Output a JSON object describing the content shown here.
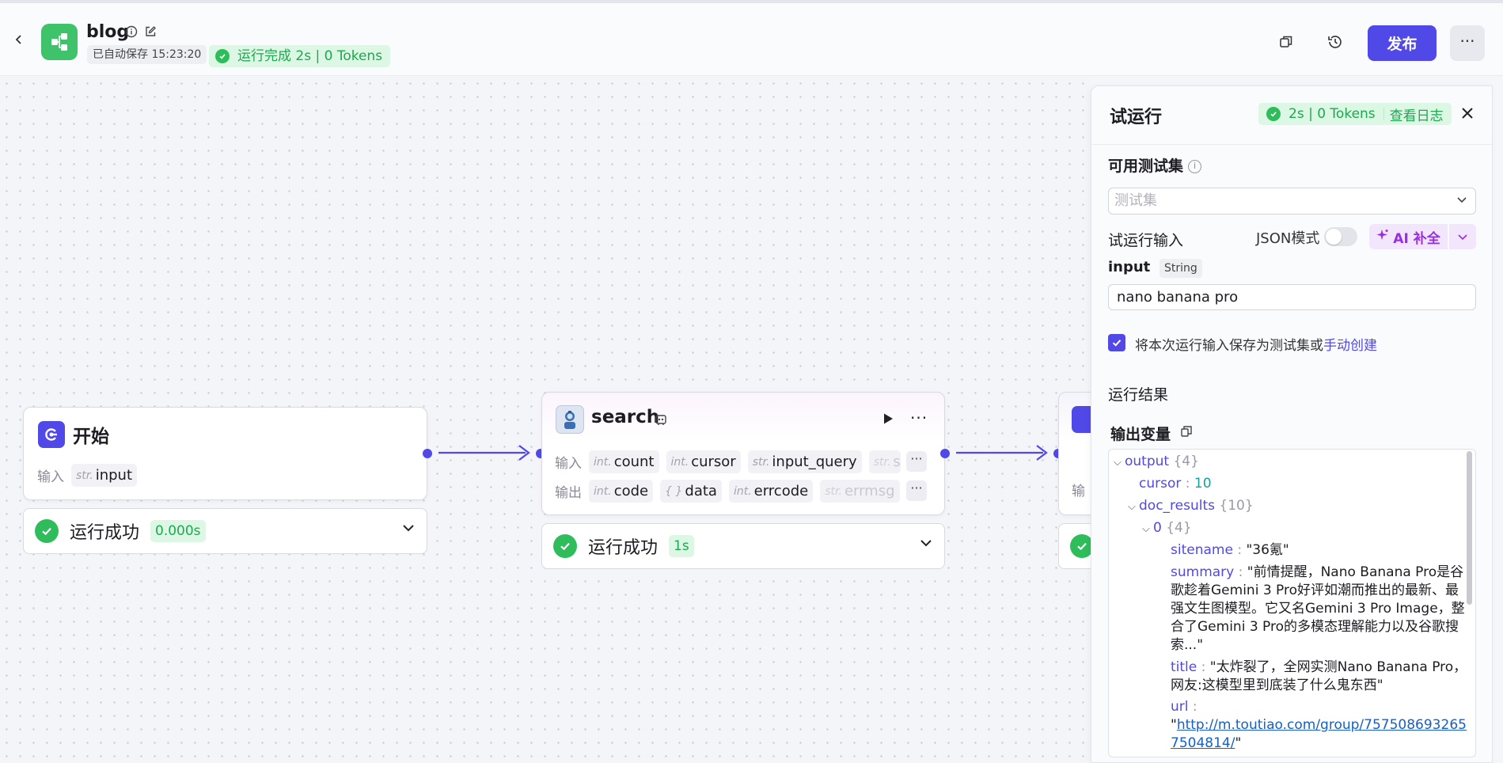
{
  "header": {
    "title": "blog",
    "autosave": "已自动保存 15:23:20",
    "run_status": "运行完成 2s | 0 Tokens",
    "publish_label": "发布",
    "more_label": "···"
  },
  "colors": {
    "accent": "#5148e8",
    "success": "#2fbd5b",
    "ai": "#9b2de0"
  },
  "canvas": {
    "start_node": {
      "title": "开始",
      "input_label": "输入",
      "inputs": [
        {
          "type": "str.",
          "name": "input"
        }
      ],
      "status": "运行成功",
      "time": "0.000s"
    },
    "search_node": {
      "title": "search",
      "input_label": "输入",
      "output_label": "输出",
      "inputs": [
        {
          "type": "int.",
          "name": "count"
        },
        {
          "type": "int.",
          "name": "cursor"
        },
        {
          "type": "str.",
          "name": "input_query"
        },
        {
          "type": "str.",
          "name": "s"
        }
      ],
      "outputs": [
        {
          "type": "int.",
          "name": "code"
        },
        {
          "type": "{ }",
          "name": "data"
        },
        {
          "type": "int.",
          "name": "errcode"
        },
        {
          "type": "str.",
          "name": "errmsg"
        }
      ],
      "more": "···",
      "status": "运行成功",
      "time": "1s"
    },
    "third_node": {
      "input_label": "输"
    }
  },
  "panel": {
    "title": "试运行",
    "badge_time": "2s | 0 Tokens",
    "badge_log": "查看日志",
    "test_set_label": "可用测试集",
    "test_set_placeholder": "测试集",
    "run_input_label": "试运行输入",
    "json_mode_label": "JSON模式",
    "json_mode_on": false,
    "ai_fill_label": "AI 补全",
    "input_name": "input",
    "input_type": "String",
    "input_value": "nano banana pro",
    "save_text": "将本次运行输入保存为测试集或",
    "save_link": "手动创建",
    "save_checked": true,
    "result_label": "运行结果",
    "output_vars_label": "输出变量",
    "tree": {
      "output_key": "output",
      "output_count": "{4}",
      "cursor_key": "cursor",
      "cursor_val": "10",
      "doc_results_key": "doc_results",
      "doc_results_count": "{10}",
      "item0_key": "0",
      "item0_count": "{4}",
      "sitename_key": "sitename",
      "sitename_val": "\"36氪\"",
      "summary_key": "summary",
      "summary_val": "\"前情提醒，Nano Banana Pro是谷歌趁着Gemini 3 Pro好评如潮而推出的最新、最强文生图模型。它又名Gemini 3 Pro Image，整合了Gemini 3 Pro的多模态理解能力以及谷歌搜索...\"",
      "title_key": "title",
      "title_val": "\"太炸裂了，全网实测Nano Banana Pro，网友:这模型里到底装了什么鬼东西\"",
      "url_key": "url",
      "url_val": "http://m.toutiao.com/group/7575086932657504814/",
      "quote": "\""
    }
  }
}
